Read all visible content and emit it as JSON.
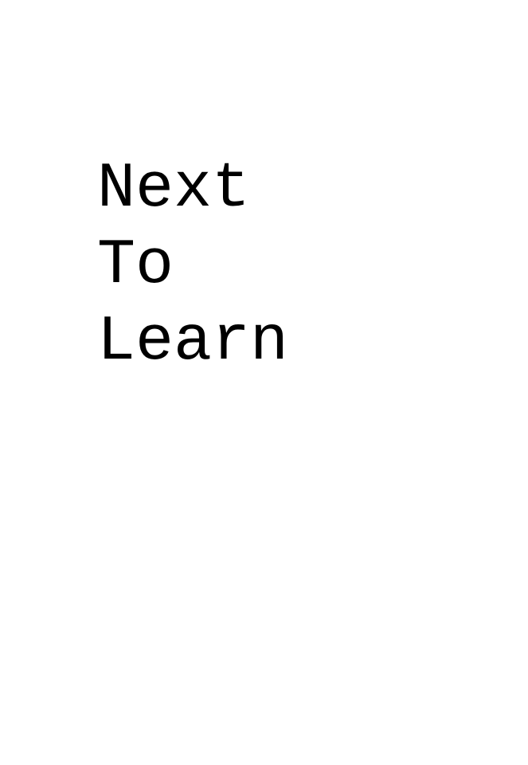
{
  "title": {
    "lines": [
      "Next",
      "To",
      "Learn"
    ]
  },
  "colors": {
    "background": "#ffffff",
    "text": "#000000"
  }
}
